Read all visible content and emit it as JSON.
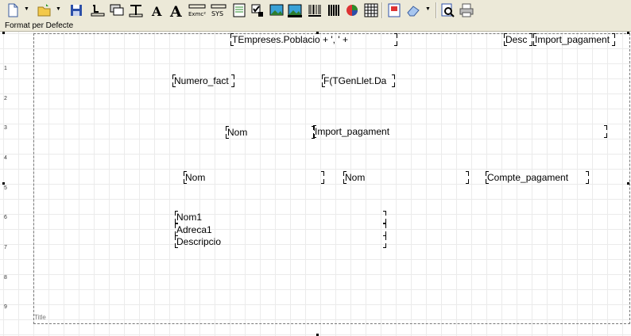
{
  "toolbar": {
    "icons": [
      "new-icon",
      "open-icon",
      "save-icon",
      "label-icon",
      "image-label-icon",
      "field-icon",
      "font-a-icon",
      "font-a-large-icon",
      "expression-icon",
      "sys-var-icon",
      "memo-icon",
      "checkbox-icon",
      "image-icon",
      "dbimage-icon",
      "barcode-icon",
      "chart-icon",
      "grid-icon",
      "properties-icon",
      "eraser-icon",
      "preview-icon",
      "print-icon"
    ],
    "expression_label": "Exmc²",
    "sysvar_label": "SYS",
    "font_a_label": "A"
  },
  "format_bar": {
    "label": "Format per Defecte"
  },
  "ruler": {
    "marks": [
      "1",
      "2",
      "3",
      "4",
      "5",
      "6",
      "7",
      "8",
      "9"
    ]
  },
  "band": {
    "title": "Title"
  },
  "fields": {
    "poblacio": "TEmpreses.Poblacio + ', ' +",
    "desc": "Desc",
    "import_pagament_top": "Import_pagament",
    "numero_fact": "Numero_fact",
    "ftgenllet": "F(TGenLlet.Da",
    "nom_1": "Nom",
    "import_pagament_mid": "Import_pagament",
    "nom_2": "Nom",
    "nom_3": "Nom",
    "compte_pagament": "Compte_pagament",
    "nom1": "Nom1",
    "adreca1": "Adreca1",
    "descripcio": "Descripcio"
  }
}
